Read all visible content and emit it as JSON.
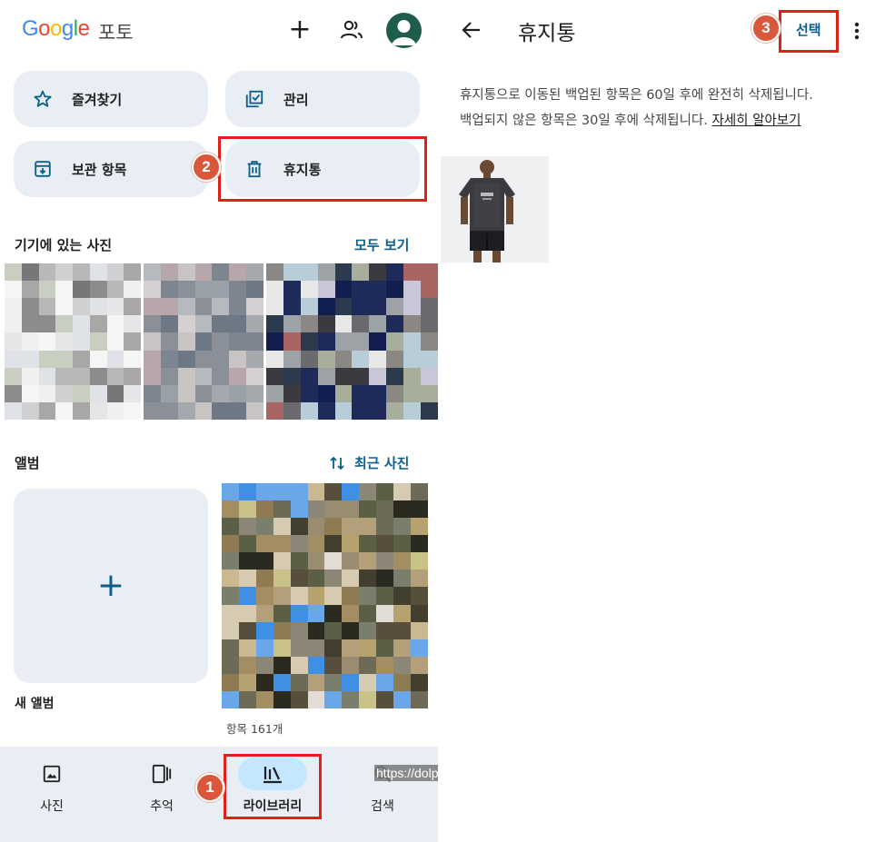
{
  "left": {
    "logo": {
      "letters": [
        "G",
        "o",
        "o",
        "g",
        "l",
        "e"
      ],
      "colors": [
        "#4285f4",
        "#ea4335",
        "#fbbc05",
        "#4285f4",
        "#34a853",
        "#ea4335"
      ],
      "suffix": "포토"
    },
    "header_icons": [
      "plus-icon",
      "shared-people-icon",
      "account-avatar"
    ],
    "tiles": {
      "favorites": "즐겨찾기",
      "manage": "관리",
      "archive": "보관 항목",
      "trash": "휴지통"
    },
    "device_photos": {
      "title": "기기에 있는 사진",
      "link": "모두 보기"
    },
    "albums": {
      "title": "앨범",
      "sort_label": "최근 사진",
      "new_album": "새 앨범",
      "album_count": "항목 161개"
    },
    "bottom_nav": [
      {
        "label": "사진",
        "icon": "photo-icon"
      },
      {
        "label": "추억",
        "icon": "memories-icon"
      },
      {
        "label": "라이브러리",
        "icon": "library-icon",
        "active": true
      },
      {
        "label": "검색",
        "icon": "search-icon"
      }
    ],
    "watermark": "https://dolpali.tistory.com/"
  },
  "annotations": {
    "badge1": "1",
    "badge2": "2",
    "badge3": "3",
    "highlight_color": "#e0201b",
    "badge_color": "#d9573a"
  },
  "right": {
    "title": "휴지통",
    "select": "선택",
    "info_line1": "휴지통으로 이동된 백업된 항목은 60일 후에 완전히 삭제됩니다.",
    "info_line2": "백업되지 않은 항목은 30일 후에 삭제됩니다.",
    "learn_more": "자세히 알아보기"
  },
  "colors": {
    "tile_bg": "#e8eef3",
    "accent": "#0b5f8a",
    "nav_active_pill": "#c2e7ff"
  }
}
